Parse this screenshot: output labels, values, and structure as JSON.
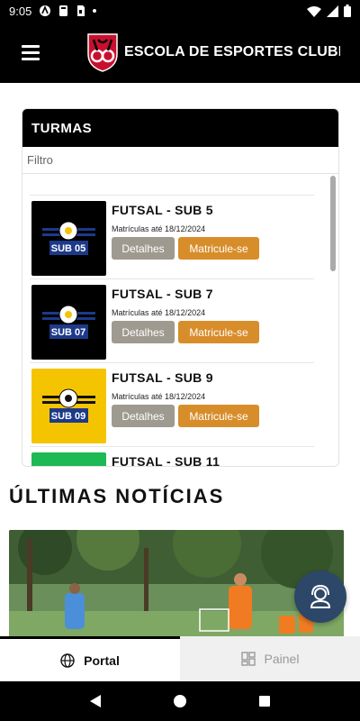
{
  "status_bar": {
    "time": "9:05"
  },
  "app_bar": {
    "title": "ESCOLA DE ESPORTES CLUBE…"
  },
  "classes_card": {
    "header": "TURMAS",
    "filter_placeholder": "Filtro",
    "items": [
      {
        "title": "FUTSAL - SUB 5",
        "date_prefix": "Matrículas até",
        "date": "18/12/2024",
        "thumb_label": "SUB 05",
        "thumb_bg": "#000000",
        "stripe": "#1d3a8a",
        "details_label": "Detalhes",
        "enroll_label": "Matricule-se"
      },
      {
        "title": "FUTSAL - SUB 7",
        "date_prefix": "Matrículas até",
        "date": "18/12/2024",
        "thumb_label": "SUB 07",
        "thumb_bg": "#000000",
        "stripe": "#1d3a8a",
        "details_label": "Detalhes",
        "enroll_label": "Matricule-se"
      },
      {
        "title": "FUTSAL - SUB 9",
        "date_prefix": "Matrículas até",
        "date": "18/12/2024",
        "thumb_label": "SUB 09",
        "thumb_bg": "#f5c400",
        "stripe": "#111111",
        "details_label": "Detalhes",
        "enroll_label": "Matricule-se"
      },
      {
        "title": "FUTSAL - SUB 11",
        "thumb_bg": "#1db954"
      }
    ]
  },
  "news": {
    "heading": "ÚLTIMAS NOTÍCIAS"
  },
  "bottom_nav": {
    "portal_label": "Portal",
    "panel_label": "Painel"
  },
  "colors": {
    "details_btn": "#9e9a8f",
    "enroll_btn": "#d88d2b",
    "fab": "#2d4768",
    "brand_red": "#c8102e"
  }
}
